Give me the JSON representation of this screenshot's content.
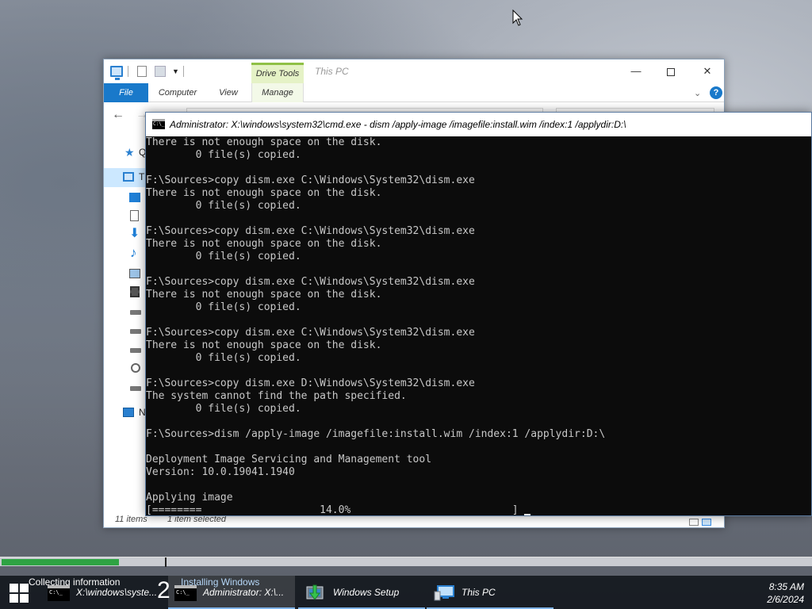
{
  "explorer": {
    "context_tab": "Drive Tools",
    "title": "This PC",
    "tabs": {
      "file": "File",
      "computer": "Computer",
      "view": "View",
      "manage": "Manage"
    },
    "min_glyph": "—",
    "close_glyph": "✕",
    "nav_letters": {
      "quick_access": "Q",
      "this_pc": "T",
      "network": "N"
    },
    "status": {
      "items": "11 items",
      "selected": "1 item selected"
    }
  },
  "cmd": {
    "title": "Administrator: X:\\windows\\system32\\cmd.exe - dism  /apply-image /imagefile:install.wim /index:1 /applydir:D:\\",
    "lines": [
      "There is not enough space on the disk.",
      "        0 file(s) copied.",
      "",
      "F:\\Sources>copy dism.exe C:\\Windows\\System32\\dism.exe",
      "There is not enough space on the disk.",
      "        0 file(s) copied.",
      "",
      "F:\\Sources>copy dism.exe C:\\Windows\\System32\\dism.exe",
      "There is not enough space on the disk.",
      "        0 file(s) copied.",
      "",
      "F:\\Sources>copy dism.exe C:\\Windows\\System32\\dism.exe",
      "There is not enough space on the disk.",
      "        0 file(s) copied.",
      "",
      "F:\\Sources>copy dism.exe C:\\Windows\\System32\\dism.exe",
      "There is not enough space on the disk.",
      "        0 file(s) copied.",
      "",
      "F:\\Sources>copy dism.exe D:\\Windows\\System32\\dism.exe",
      "The system cannot find the path specified.",
      "        0 file(s) copied.",
      "",
      "F:\\Sources>dism /apply-image /imagefile:install.wim /index:1 /applydir:D:\\",
      "",
      "Deployment Image Servicing and Management tool",
      "Version: 10.0.19041.1940",
      "",
      "Applying image"
    ],
    "progress_line": "[========                   14.0%                          ] "
  },
  "setup_progress": {
    "fraction": 0.145
  },
  "taskbar": {
    "collecting": "Collecting information",
    "installing": "Installing Windows",
    "step": "2",
    "items": [
      {
        "label": "X:\\windows\\syste...",
        "icon": "cmd-icon"
      },
      {
        "label": "Administrator: X:\\...",
        "icon": "cmd-icon"
      },
      {
        "label": "Windows Setup",
        "icon": "setup-icon"
      },
      {
        "label": "This PC",
        "icon": "computer-icon"
      }
    ],
    "cmd_icon_text": "C:\\_",
    "time": "8:35 AM",
    "date": "2/6/2024"
  }
}
